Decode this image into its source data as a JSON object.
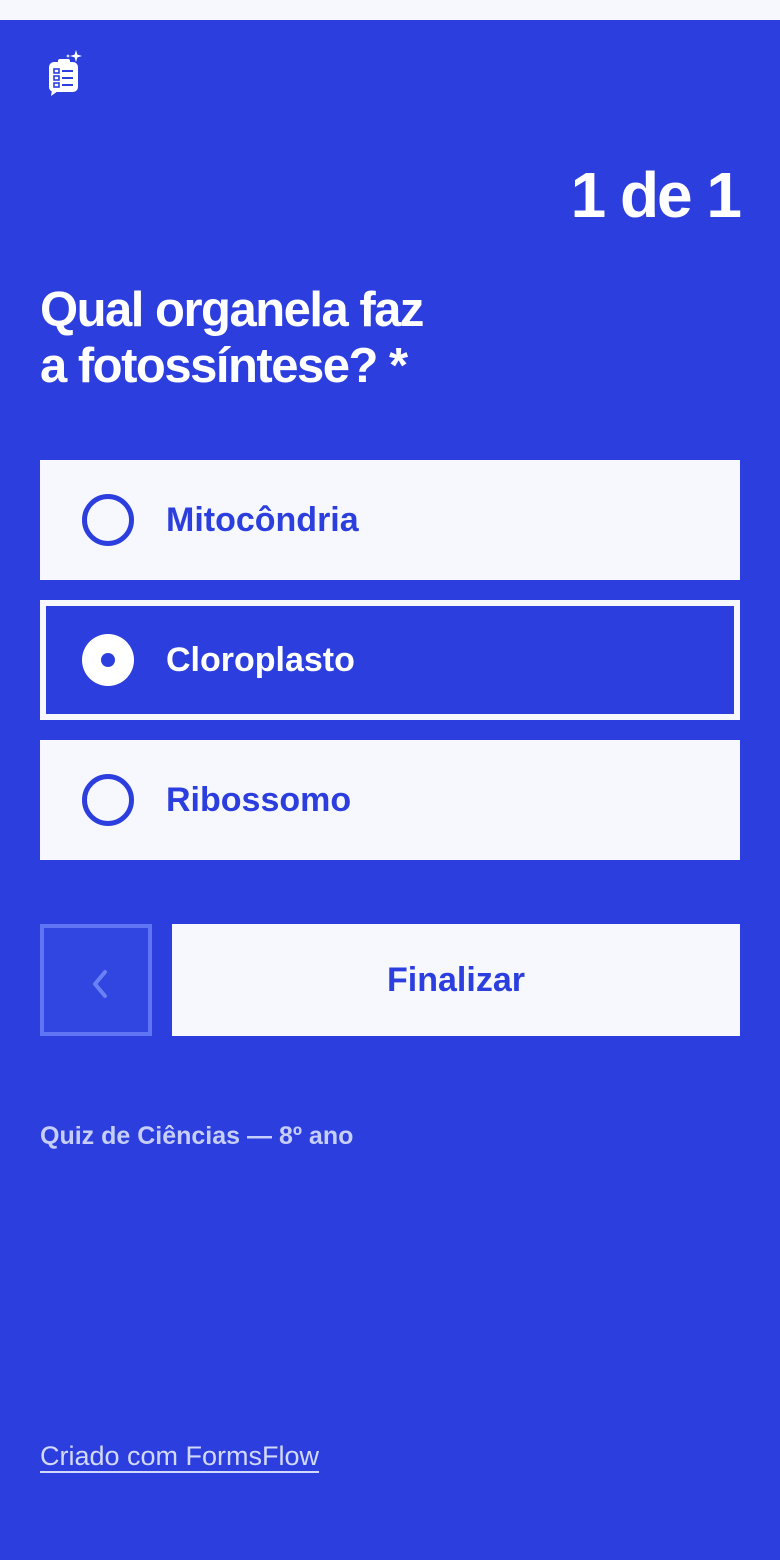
{
  "header": {
    "logo_icon": "form-checklist-icon",
    "progress": "1 de 1"
  },
  "question": {
    "line1": "Qual organela faz",
    "line2": "a fotossíntese? *"
  },
  "options": [
    {
      "label": "Mitocôndria",
      "selected": false
    },
    {
      "label": "Cloroplasto",
      "selected": true
    },
    {
      "label": "Ribossomo",
      "selected": false
    }
  ],
  "navigation": {
    "back_icon": "chevron-left-icon",
    "finish_label": "Finalizar"
  },
  "footer": {
    "quiz_title": "Quiz de Ciências — 8º ano",
    "credit": "Criado com FormsFlow"
  },
  "colors": {
    "primary": "#2c3fde",
    "surface": "#f6f8fd"
  }
}
